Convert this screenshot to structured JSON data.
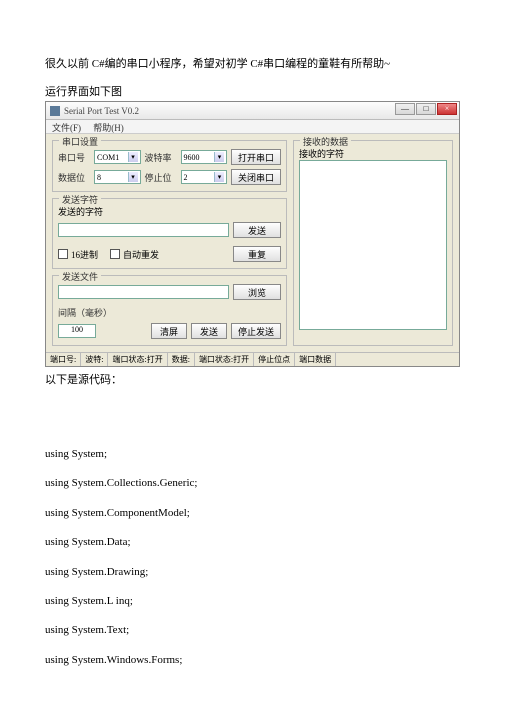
{
  "intro": "很久以前 C#编的串口小程序，希望对初学 C#串口编程的童鞋有所帮助~",
  "caption": "运行界面如下图",
  "window": {
    "title": "Serial Port Test V0.2",
    "menu": {
      "file": "文件(F)",
      "help": "帮助(H)"
    },
    "serial_group": {
      "title": "串口设置",
      "port_lbl": "串口号",
      "port_val": "COM1",
      "baud_lbl": "波特率",
      "baud_val": "9600",
      "databit_lbl": "数据位",
      "databit_val": "8",
      "stopbit_lbl": "停止位",
      "stopbit_val": "2",
      "open_btn": "打开串口",
      "close_btn": "关闭串口"
    },
    "send_group": {
      "title": "发送字符",
      "label": "发送的字符",
      "send_btn": "发送",
      "manual_btn": "重复",
      "hex_ck": "16进制",
      "auto_ck": "自动重发"
    },
    "recv_group": {
      "title": "发送文件",
      "browse_btn": "浏览"
    },
    "timer_group": {
      "interval_lbl": "间隔（毫秒）",
      "interval_val": "100",
      "btn1": "清屏",
      "btn2": "发送",
      "btn3": "停止发送"
    },
    "right_group": {
      "title": "接收的数据",
      "sub": "接收的字符"
    },
    "status": {
      "c1": "端口号:",
      "c2": "波特:",
      "c3": "端口状态:打开",
      "c4": "数据:",
      "c5": "端口状态:打开",
      "c6": "停止位点",
      "c7": "端口数据"
    }
  },
  "after": "以下是源代码：",
  "code": [
    "using System;",
    "using System.Collections.Generic;",
    "using System.ComponentModel;",
    "using System.Data;",
    "using System.Drawing;",
    "using System.L inq;",
    "using System.Text;",
    "using System.Windows.Forms;"
  ]
}
